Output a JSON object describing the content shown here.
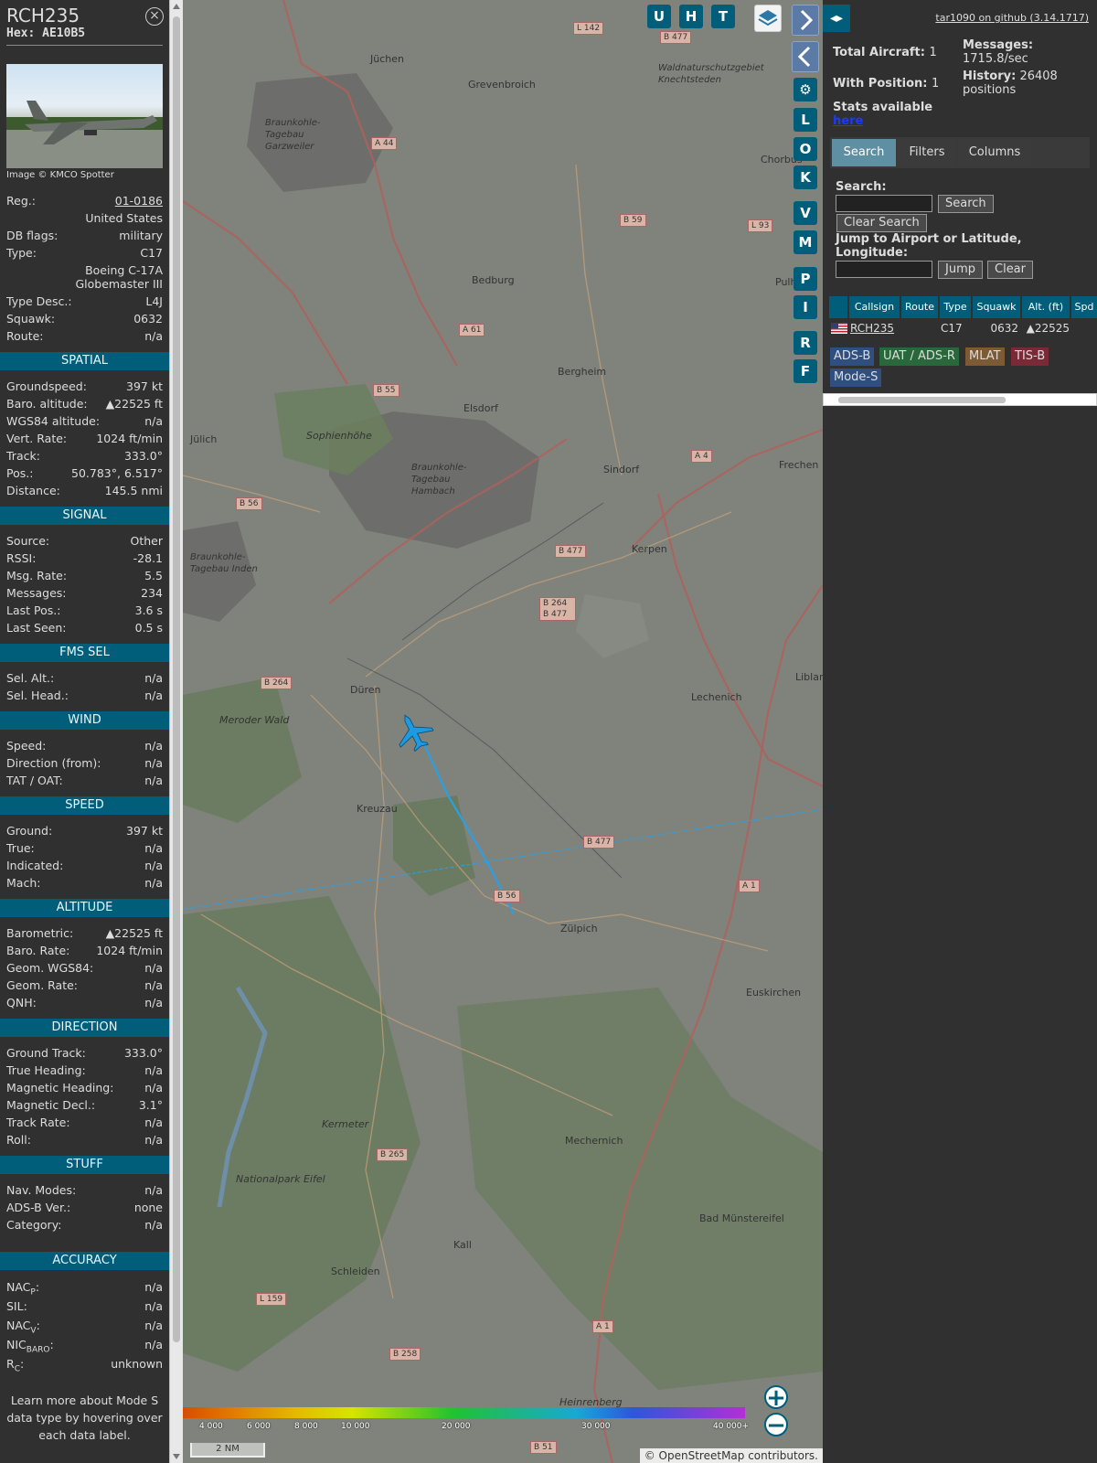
{
  "info": {
    "callsign": "RCH235",
    "hex_line": "Hex: AE10B5",
    "close_glyph": "×",
    "photo_caption": "Image © KMCO Spotter",
    "fields": [
      {
        "k": "Reg.:",
        "v": "01-0186"
      },
      {
        "k": "",
        "v": "United States"
      },
      {
        "k": "DB flags:",
        "v": "military"
      },
      {
        "k": "Type:",
        "v": "C17"
      },
      {
        "k": "",
        "v": "Boeing C-17A Globemaster III"
      },
      {
        "k": "Type Desc.:",
        "v": "L4J"
      },
      {
        "k": "Squawk:",
        "v": "0632"
      },
      {
        "k": "Route:",
        "v": "n/a"
      }
    ],
    "sections": [
      {
        "title": "SPATIAL",
        "rows": [
          {
            "k": "Groundspeed:",
            "v": "397 kt"
          },
          {
            "k": "Baro. altitude:",
            "v": "▲22525 ft"
          },
          {
            "k": "WGS84 altitude:",
            "v": "n/a"
          },
          {
            "k": "Vert. Rate:",
            "v": "1024 ft/min"
          },
          {
            "k": "Track:",
            "v": "333.0°"
          },
          {
            "k": "Pos.:",
            "v": "50.783°, 6.517°"
          },
          {
            "k": "Distance:",
            "v": "145.5 nmi"
          }
        ]
      },
      {
        "title": "SIGNAL",
        "rows": [
          {
            "k": "Source:",
            "v": "Other"
          },
          {
            "k": "RSSI:",
            "v": "-28.1"
          },
          {
            "k": "Msg. Rate:",
            "v": "5.5"
          },
          {
            "k": "Messages:",
            "v": "234"
          },
          {
            "k": "Last Pos.:",
            "v": "3.6 s"
          },
          {
            "k": "Last Seen:",
            "v": "0.5 s"
          }
        ]
      },
      {
        "title": "FMS SEL",
        "rows": [
          {
            "k": "Sel. Alt.:",
            "v": "n/a"
          },
          {
            "k": "Sel. Head.:",
            "v": "n/a"
          }
        ]
      },
      {
        "title": "WIND",
        "rows": [
          {
            "k": "Speed:",
            "v": "n/a"
          },
          {
            "k": "Direction (from):",
            "v": "n/a"
          },
          {
            "k": "TAT / OAT:",
            "v": "n/a"
          }
        ]
      },
      {
        "title": "SPEED",
        "rows": [
          {
            "k": "Ground:",
            "v": "397 kt"
          },
          {
            "k": "True:",
            "v": "n/a"
          },
          {
            "k": "Indicated:",
            "v": "n/a"
          },
          {
            "k": "Mach:",
            "v": "n/a"
          }
        ]
      },
      {
        "title": "ALTITUDE",
        "rows": [
          {
            "k": "Barometric:",
            "v": "▲22525 ft"
          },
          {
            "k": "Baro. Rate:",
            "v": "1024 ft/min"
          },
          {
            "k": "Geom. WGS84:",
            "v": "n/a"
          },
          {
            "k": "Geom. Rate:",
            "v": "n/a"
          },
          {
            "k": "QNH:",
            "v": "n/a"
          }
        ]
      },
      {
        "title": "DIRECTION",
        "rows": [
          {
            "k": "Ground Track:",
            "v": "333.0°"
          },
          {
            "k": "True Heading:",
            "v": "n/a"
          },
          {
            "k": "Magnetic Heading:",
            "v": "n/a"
          },
          {
            "k": "Magnetic Decl.:",
            "v": "3.1°"
          },
          {
            "k": "Track Rate:",
            "v": "n/a"
          },
          {
            "k": "Roll:",
            "v": "n/a"
          }
        ]
      },
      {
        "title": "STUFF",
        "rows": [
          {
            "k": "Nav. Modes:",
            "v": "n/a"
          },
          {
            "k": "ADS-B Ver.:",
            "v": "none"
          },
          {
            "k": "Category:",
            "v": "n/a"
          }
        ]
      }
    ],
    "accuracy_title": "ACCURACY",
    "accuracy": [
      {
        "k": "NAC",
        "sub": "P",
        "v": "n/a"
      },
      {
        "k": "SIL",
        "sub": "",
        "v": "n/a"
      },
      {
        "k": "NAC",
        "sub": "V",
        "v": "n/a"
      },
      {
        "k": "NIC",
        "sub": "BARO",
        "v": "n/a"
      },
      {
        "k": "R",
        "sub": "C",
        "v": "unknown"
      }
    ],
    "note": "Learn more about Mode S data type by hovering over each data label."
  },
  "map": {
    "buttons_top": [
      "U",
      "H",
      "T"
    ],
    "buttons_side": [
      "L",
      "O",
      "K",
      "V",
      "M",
      "P",
      "I",
      "R",
      "F"
    ],
    "settings_icon": "⚙",
    "zoom_in": "+",
    "zoom_out": "−",
    "scale_label": "2 NM",
    "attribution": "© OpenStreetMap contributors.",
    "color_bar_labels": [
      "4 000",
      "6 000",
      "8 000",
      "10 000",
      "20 000",
      "30 000",
      "40 000+"
    ],
    "place_labels": [
      "Jüchen",
      "Grevenbroich",
      "Braunkohle-Tagebau Garzweiler",
      "Bedburg",
      "Bergheim",
      "Elsdorf",
      "Jülich",
      "Sophienhöhe",
      "Braunkohle-Tagebau Hambach",
      "Sindorf",
      "Kerpen",
      "Frechen",
      "Braunkohle-Tagebau Inden",
      "Düren",
      "Lechenich",
      "Meroder Wald",
      "Kreuzau",
      "Zülpich",
      "Euskirchen",
      "Kermeter",
      "Mechernich",
      "Nationalpark Eifel",
      "Bad Münstereifel",
      "Kall",
      "Schleiden",
      "Heinrenberg",
      "Waldnaturschutzgebiet Knechtsteden",
      "Liblar",
      "Pulh",
      "Chorbus"
    ],
    "road_labels": [
      "L 142",
      "B 477",
      "A 44",
      "B 59",
      "L 93",
      "A 61",
      "B 55",
      "B 56",
      "B 477",
      "B 264 B 477",
      "B 264",
      "A 4",
      "B 477",
      "B 56",
      "A 1",
      "B 265",
      "B 258",
      "L 159",
      "A 1",
      "B 51"
    ],
    "colors": {
      "track": "#1e9be0",
      "aircraft": "#1e9be0",
      "bg": "#7f837c"
    }
  },
  "right": {
    "swap_icon": "◂▸",
    "github": "tar1090 on github (3.14.1717)",
    "total_label": "Total Aircraft:",
    "total_value": "1",
    "withpos_label": "With Position:",
    "withpos_value": "1",
    "messages_label": "Messages:",
    "messages_value": "1715.8/sec",
    "history_label": "History:",
    "history_value": "26408 positions",
    "stats_label": "Stats available",
    "stats_link": "here",
    "tabs": [
      "Search",
      "Filters",
      "Columns"
    ],
    "search_label": "Search:",
    "search_button": "Search",
    "clear_search_button": "Clear Search",
    "jump_label": "Jump to Airport or Latitude, Longitude:",
    "jump_button": "Jump",
    "clear_button": "Clear",
    "columns": [
      "",
      "Callsign",
      "Route",
      "Type",
      "Squawk",
      "Alt. (ft)",
      "Spd"
    ],
    "rows": [
      {
        "flag": "us-flag",
        "callsign": "RCH235",
        "route": "",
        "type": "C17",
        "squawk": "0632",
        "alt": "▲22525",
        "spd": ""
      }
    ],
    "legend": [
      "ADS-B",
      "UAT / ADS-R",
      "MLAT",
      "TIS-B",
      "Mode-S"
    ],
    "legend_colors": [
      "#2f4f80",
      "#28683a",
      "#7c5a34",
      "#7a2936",
      "#2f4f80"
    ]
  }
}
